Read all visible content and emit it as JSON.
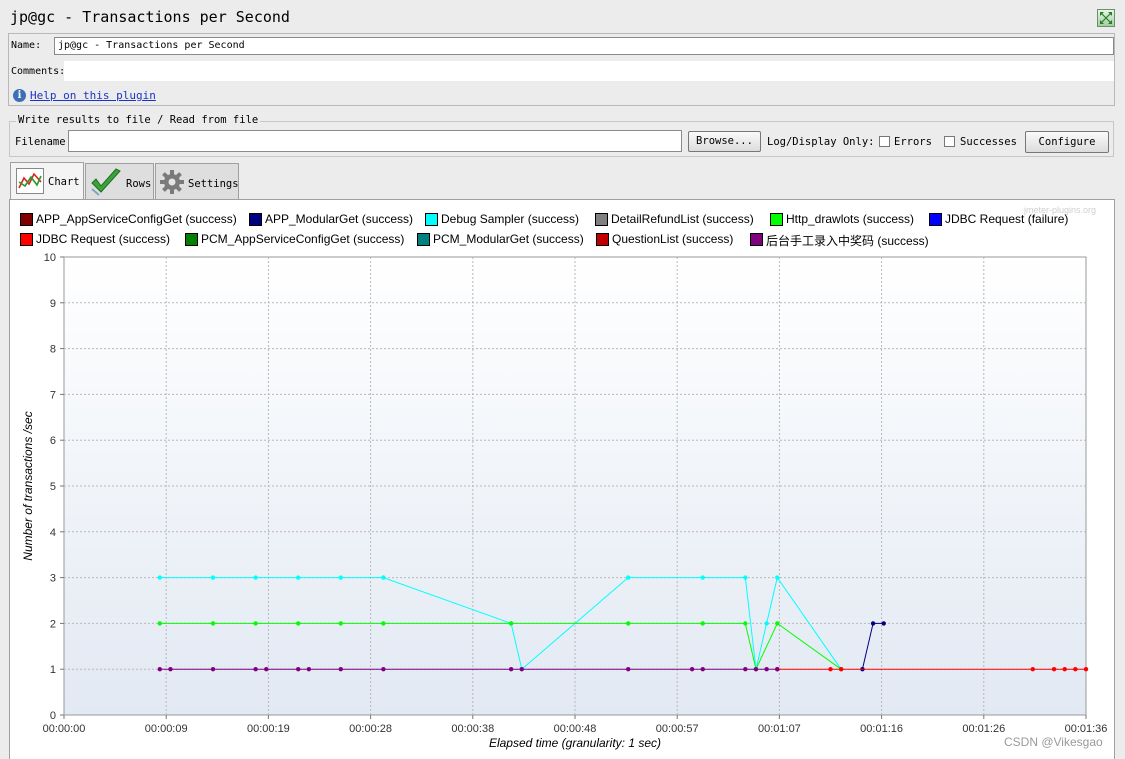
{
  "window": {
    "title": "jp@gc - Transactions per Second"
  },
  "info": {
    "name_label": "Name:",
    "name_value": "jp@gc - Transactions per Second",
    "comments_label": "Comments:",
    "help_icon": "info-icon",
    "help_link": "Help on this plugin"
  },
  "file": {
    "legend": "Write results to file / Read from file",
    "filename_label": "Filename",
    "filename_value": "",
    "browse": "Browse...",
    "log_label": "Log/Display Only:",
    "errors_label": "Errors",
    "successes_label": "Successes",
    "configure": "Configure"
  },
  "tabs": [
    {
      "label": "Chart",
      "icon": "chart-icon",
      "active": true
    },
    {
      "label": "Rows",
      "icon": "checkmark-icon",
      "active": false
    },
    {
      "label": "Settings",
      "icon": "gear-icon",
      "active": false
    }
  ],
  "watermark": "jmeter-plugins.org",
  "credit": "CSDN @Vikesgao",
  "legend": [
    {
      "label": "APP_AppServiceConfigGet (success)",
      "color": "#800000"
    },
    {
      "label": "APP_ModularGet (success)",
      "color": "#000080"
    },
    {
      "label": "Debug Sampler (success)",
      "color": "#00ffff"
    },
    {
      "label": "DetailRefundList (success)",
      "color": "#808080"
    },
    {
      "label": "Http_drawlots (success)",
      "color": "#00ff00"
    },
    {
      "label": "JDBC Request (failure)",
      "color": "#0000ff"
    },
    {
      "label": "JDBC Request (success)",
      "color": "#ff0000"
    },
    {
      "label": "PCM_AppServiceConfigGet (success)",
      "color": "#008000"
    },
    {
      "label": "PCM_ModularGet (success)",
      "color": "#008080"
    },
    {
      "label": "QuestionList (success)",
      "color": "#c00000"
    },
    {
      "label": "后台手工录入中奖码 (success)",
      "color": "#800080"
    }
  ],
  "chart_data": {
    "type": "line",
    "xlabel": "Elapsed time (granularity: 1 sec)",
    "ylabel": "Number of transactions /sec",
    "xlim": [
      0,
      96
    ],
    "ylim": [
      0,
      10
    ],
    "yticks": [
      0,
      1,
      2,
      3,
      4,
      5,
      6,
      7,
      8,
      9,
      10
    ],
    "xticks": [
      0,
      9.6,
      19.2,
      28.8,
      38.4,
      48,
      57.6,
      67.2,
      76.8,
      86.4,
      96
    ],
    "xtick_labels": [
      "00:00:00",
      "00:00:09",
      "00:00:19",
      "00:00:28",
      "00:00:38",
      "00:00:48",
      "00:00:57",
      "00:01:07",
      "00:01:16",
      "00:01:26",
      "00:01:36"
    ],
    "grid": true,
    "series": [
      {
        "name": "Debug Sampler (success)",
        "color": "#00ffff",
        "points": [
          [
            9,
            3
          ],
          [
            14,
            3
          ],
          [
            18,
            3
          ],
          [
            22,
            3
          ],
          [
            26,
            3
          ],
          [
            30,
            3
          ],
          [
            42,
            2
          ],
          [
            43,
            1
          ],
          [
            53,
            3
          ],
          [
            60,
            3
          ],
          [
            64,
            3
          ],
          [
            65,
            1
          ],
          [
            66,
            2
          ],
          [
            67,
            3
          ],
          [
            73,
            1
          ]
        ]
      },
      {
        "name": "Http_drawlots (success)",
        "color": "#00ff00",
        "points": [
          [
            9,
            2
          ],
          [
            14,
            2
          ],
          [
            18,
            2
          ],
          [
            22,
            2
          ],
          [
            26,
            2
          ],
          [
            30,
            2
          ],
          [
            42,
            2
          ],
          [
            53,
            2
          ],
          [
            60,
            2
          ],
          [
            64,
            2
          ],
          [
            65,
            1
          ],
          [
            67,
            2
          ],
          [
            73,
            1
          ]
        ]
      },
      {
        "name": "JDBC Request (failure)",
        "color": "#000080",
        "points": [
          [
            75,
            1
          ],
          [
            76,
            2
          ],
          [
            77,
            2
          ]
        ]
      },
      {
        "name": "JDBC Request (success)",
        "color": "#ff0000",
        "points": [
          [
            67,
            1
          ],
          [
            72,
            1
          ],
          [
            73,
            1
          ],
          [
            91,
            1
          ],
          [
            93,
            1
          ],
          [
            94,
            1
          ],
          [
            95,
            1
          ],
          [
            96,
            1
          ]
        ]
      },
      {
        "name": "后台手工录入中奖码 (success)",
        "color": "#800080",
        "points": [
          [
            9,
            1
          ],
          [
            10,
            1
          ],
          [
            14,
            1
          ],
          [
            18,
            1
          ],
          [
            19,
            1
          ],
          [
            22,
            1
          ],
          [
            23,
            1
          ],
          [
            26,
            1
          ],
          [
            30,
            1
          ],
          [
            42,
            1
          ],
          [
            43,
            1
          ],
          [
            53,
            1
          ],
          [
            59,
            1
          ],
          [
            60,
            1
          ],
          [
            64,
            1
          ],
          [
            65,
            1
          ],
          [
            66,
            1
          ],
          [
            67,
            1
          ]
        ]
      }
    ]
  }
}
